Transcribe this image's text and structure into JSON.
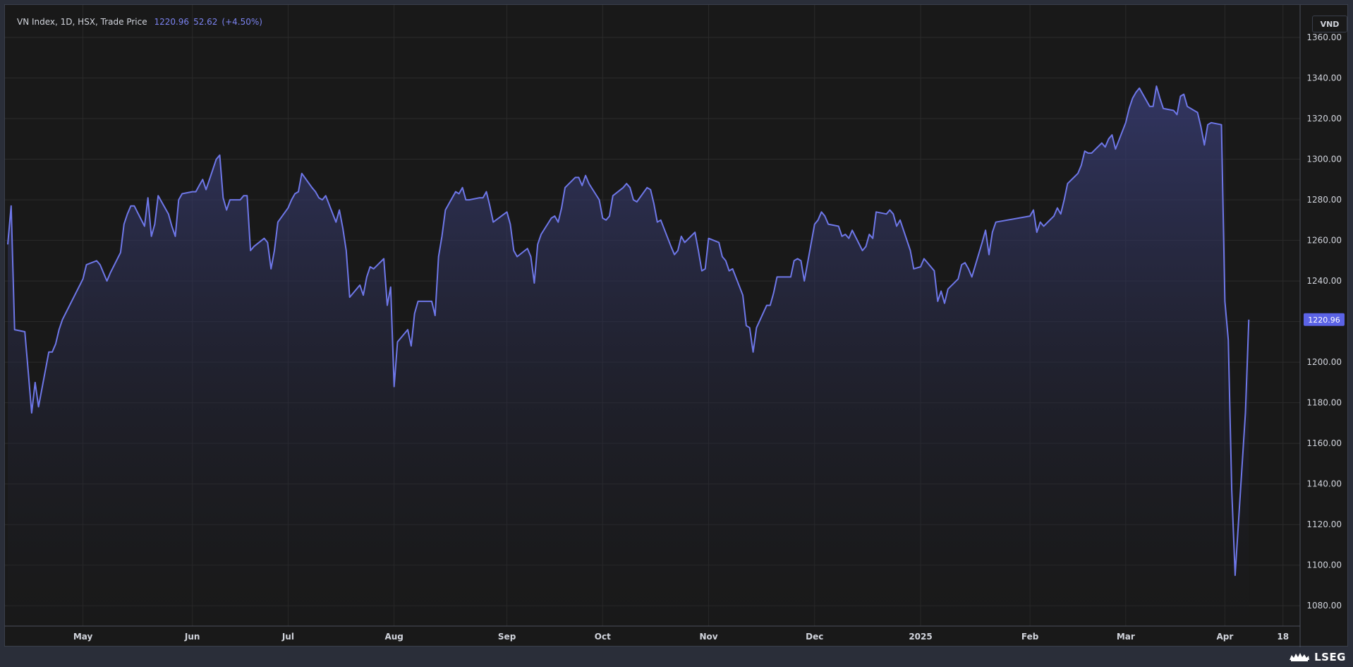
{
  "legend": {
    "title": "VN Index, 1D, HSX, Trade Price",
    "last": "1220.96",
    "change": "52.62",
    "change_pct": "(+4.50%)"
  },
  "currency": "VND",
  "last_price_label": "1220.96",
  "brand": {
    "name": "LSEG",
    "icon": "lseg-logo-icon"
  },
  "colors": {
    "line": "#6e77e8",
    "fill_top": "#3a3f7a",
    "fill_bottom": "#191919",
    "background": "#191919",
    "grid": "#2b2b2b",
    "label_bg": "#5b63e6"
  },
  "chart_data": {
    "type": "area",
    "title": "",
    "xlabel": "",
    "ylabel": "",
    "ylim": [
      1070,
      1376
    ],
    "y_ticks": [
      "1080.00",
      "1100.00",
      "1120.00",
      "1140.00",
      "1160.00",
      "1180.00",
      "1200.00",
      "1220.00",
      "1240.00",
      "1260.00",
      "1280.00",
      "1300.00",
      "1320.00",
      "1340.00",
      "1360.00"
    ],
    "x_ticks": [
      {
        "label": "May",
        "date": "2024-05-02"
      },
      {
        "label": "Jun",
        "date": "2024-06-03"
      },
      {
        "label": "Jul",
        "date": "2024-07-01"
      },
      {
        "label": "Aug",
        "date": "2024-08-01"
      },
      {
        "label": "Sep",
        "date": "2024-09-03"
      },
      {
        "label": "Oct",
        "date": "2024-10-01"
      },
      {
        "label": "Nov",
        "date": "2024-11-01"
      },
      {
        "label": "Dec",
        "date": "2024-12-02"
      },
      {
        "label": "2025",
        "date": "2025-01-02"
      },
      {
        "label": "Feb",
        "date": "2025-02-03"
      },
      {
        "label": "Mar",
        "date": "2025-03-03"
      },
      {
        "label": "Apr",
        "date": "2025-04-01"
      },
      {
        "label": "18",
        "date": "2025-04-18"
      }
    ],
    "x_range": [
      "2024-04-10",
      "2025-04-23"
    ],
    "series": [
      {
        "points": [
          [
            "2024-04-10",
            1258
          ],
          [
            "2024-04-11",
            1277
          ],
          [
            "2024-04-12",
            1216
          ],
          [
            "2024-04-15",
            1215
          ],
          [
            "2024-04-16",
            1195
          ],
          [
            "2024-04-17",
            1175
          ],
          [
            "2024-04-18",
            1190
          ],
          [
            "2024-04-19",
            1178
          ],
          [
            "2024-04-22",
            1205
          ],
          [
            "2024-04-23",
            1205
          ],
          [
            "2024-04-24",
            1209
          ],
          [
            "2024-04-25",
            1216
          ],
          [
            "2024-04-26",
            1221
          ],
          [
            "2024-05-02",
            1241
          ],
          [
            "2024-05-03",
            1248
          ],
          [
            "2024-05-06",
            1250
          ],
          [
            "2024-05-07",
            1248
          ],
          [
            "2024-05-08",
            1244
          ],
          [
            "2024-05-09",
            1240
          ],
          [
            "2024-05-10",
            1244
          ],
          [
            "2024-05-13",
            1254
          ],
          [
            "2024-05-14",
            1268
          ],
          [
            "2024-05-15",
            1273
          ],
          [
            "2024-05-16",
            1277
          ],
          [
            "2024-05-17",
            1277
          ],
          [
            "2024-05-20",
            1267
          ],
          [
            "2024-05-21",
            1281
          ],
          [
            "2024-05-22",
            1262
          ],
          [
            "2024-05-23",
            1268
          ],
          [
            "2024-05-24",
            1282
          ],
          [
            "2024-05-27",
            1273
          ],
          [
            "2024-05-28",
            1267
          ],
          [
            "2024-05-29",
            1262
          ],
          [
            "2024-05-30",
            1280
          ],
          [
            "2024-05-31",
            1283
          ],
          [
            "2024-06-03",
            1284
          ],
          [
            "2024-06-04",
            1284
          ],
          [
            "2024-06-05",
            1287
          ],
          [
            "2024-06-06",
            1290
          ],
          [
            "2024-06-07",
            1285
          ],
          [
            "2024-06-10",
            1300
          ],
          [
            "2024-06-11",
            1302
          ],
          [
            "2024-06-12",
            1281
          ],
          [
            "2024-06-13",
            1275
          ],
          [
            "2024-06-14",
            1280
          ],
          [
            "2024-06-17",
            1280
          ],
          [
            "2024-06-18",
            1282
          ],
          [
            "2024-06-19",
            1282
          ],
          [
            "2024-06-20",
            1255
          ],
          [
            "2024-06-21",
            1257
          ],
          [
            "2024-06-24",
            1261
          ],
          [
            "2024-06-25",
            1259
          ],
          [
            "2024-06-26",
            1246
          ],
          [
            "2024-06-27",
            1255
          ],
          [
            "2024-06-28",
            1269
          ],
          [
            "2024-07-01",
            1276
          ],
          [
            "2024-07-02",
            1280
          ],
          [
            "2024-07-03",
            1283
          ],
          [
            "2024-07-04",
            1284
          ],
          [
            "2024-07-05",
            1293
          ],
          [
            "2024-07-08",
            1286
          ],
          [
            "2024-07-09",
            1284
          ],
          [
            "2024-07-10",
            1281
          ],
          [
            "2024-07-11",
            1280
          ],
          [
            "2024-07-12",
            1282
          ],
          [
            "2024-07-15",
            1269
          ],
          [
            "2024-07-16",
            1275
          ],
          [
            "2024-07-17",
            1266
          ],
          [
            "2024-07-18",
            1255
          ],
          [
            "2024-07-19",
            1232
          ],
          [
            "2024-07-22",
            1238
          ],
          [
            "2024-07-23",
            1233
          ],
          [
            "2024-07-24",
            1242
          ],
          [
            "2024-07-25",
            1247
          ],
          [
            "2024-07-26",
            1246
          ],
          [
            "2024-07-29",
            1251
          ],
          [
            "2024-07-30",
            1228
          ],
          [
            "2024-07-31",
            1237
          ],
          [
            "2024-08-01",
            1188
          ],
          [
            "2024-08-02",
            1210
          ],
          [
            "2024-08-05",
            1216
          ],
          [
            "2024-08-06",
            1208
          ],
          [
            "2024-08-07",
            1224
          ],
          [
            "2024-08-08",
            1230
          ],
          [
            "2024-08-09",
            1230
          ],
          [
            "2024-08-12",
            1230
          ],
          [
            "2024-08-13",
            1223
          ],
          [
            "2024-08-14",
            1252
          ],
          [
            "2024-08-15",
            1262
          ],
          [
            "2024-08-16",
            1275
          ],
          [
            "2024-08-19",
            1284
          ],
          [
            "2024-08-20",
            1283
          ],
          [
            "2024-08-21",
            1286
          ],
          [
            "2024-08-22",
            1280
          ],
          [
            "2024-08-23",
            1280
          ],
          [
            "2024-08-26",
            1281
          ],
          [
            "2024-08-27",
            1281
          ],
          [
            "2024-08-28",
            1284
          ],
          [
            "2024-08-29",
            1277
          ],
          [
            "2024-08-30",
            1269
          ],
          [
            "2024-09-03",
            1274
          ],
          [
            "2024-09-04",
            1268
          ],
          [
            "2024-09-05",
            1255
          ],
          [
            "2024-09-06",
            1252
          ],
          [
            "2024-09-09",
            1256
          ],
          [
            "2024-09-10",
            1252
          ],
          [
            "2024-09-11",
            1239
          ],
          [
            "2024-09-12",
            1258
          ],
          [
            "2024-09-13",
            1263
          ],
          [
            "2024-09-16",
            1271
          ],
          [
            "2024-09-17",
            1272
          ],
          [
            "2024-09-18",
            1269
          ],
          [
            "2024-09-19",
            1276
          ],
          [
            "2024-09-20",
            1286
          ],
          [
            "2024-09-23",
            1291
          ],
          [
            "2024-09-24",
            1291
          ],
          [
            "2024-09-25",
            1287
          ],
          [
            "2024-09-26",
            1292
          ],
          [
            "2024-09-27",
            1288
          ],
          [
            "2024-09-30",
            1280
          ],
          [
            "2024-10-01",
            1271
          ],
          [
            "2024-10-02",
            1270
          ],
          [
            "2024-10-03",
            1272
          ],
          [
            "2024-10-04",
            1282
          ],
          [
            "2024-10-07",
            1286
          ],
          [
            "2024-10-08",
            1288
          ],
          [
            "2024-10-09",
            1286
          ],
          [
            "2024-10-10",
            1280
          ],
          [
            "2024-10-11",
            1279
          ],
          [
            "2024-10-14",
            1286
          ],
          [
            "2024-10-15",
            1285
          ],
          [
            "2024-10-16",
            1278
          ],
          [
            "2024-10-17",
            1269
          ],
          [
            "2024-10-18",
            1270
          ],
          [
            "2024-10-21",
            1257
          ],
          [
            "2024-10-22",
            1253
          ],
          [
            "2024-10-23",
            1255
          ],
          [
            "2024-10-24",
            1262
          ],
          [
            "2024-10-25",
            1259
          ],
          [
            "2024-10-28",
            1264
          ],
          [
            "2024-10-29",
            1255
          ],
          [
            "2024-10-30",
            1245
          ],
          [
            "2024-10-31",
            1246
          ],
          [
            "2024-11-01",
            1261
          ],
          [
            "2024-11-04",
            1259
          ],
          [
            "2024-11-05",
            1252
          ],
          [
            "2024-11-06",
            1250
          ],
          [
            "2024-11-07",
            1245
          ],
          [
            "2024-11-08",
            1246
          ],
          [
            "2024-11-11",
            1233
          ],
          [
            "2024-11-12",
            1218
          ],
          [
            "2024-11-13",
            1217
          ],
          [
            "2024-11-14",
            1205
          ],
          [
            "2024-11-15",
            1217
          ],
          [
            "2024-11-18",
            1228
          ],
          [
            "2024-11-19",
            1228
          ],
          [
            "2024-11-20",
            1234
          ],
          [
            "2024-11-21",
            1242
          ],
          [
            "2024-11-22",
            1242
          ],
          [
            "2024-11-25",
            1242
          ],
          [
            "2024-11-26",
            1250
          ],
          [
            "2024-11-27",
            1251
          ],
          [
            "2024-11-28",
            1250
          ],
          [
            "2024-11-29",
            1240
          ],
          [
            "2024-12-02",
            1268
          ],
          [
            "2024-12-03",
            1270
          ],
          [
            "2024-12-04",
            1274
          ],
          [
            "2024-12-05",
            1272
          ],
          [
            "2024-12-06",
            1268
          ],
          [
            "2024-12-09",
            1267
          ],
          [
            "2024-12-10",
            1262
          ],
          [
            "2024-12-11",
            1263
          ],
          [
            "2024-12-12",
            1261
          ],
          [
            "2024-12-13",
            1265
          ],
          [
            "2024-12-16",
            1255
          ],
          [
            "2024-12-17",
            1257
          ],
          [
            "2024-12-18",
            1263
          ],
          [
            "2024-12-19",
            1261
          ],
          [
            "2024-12-20",
            1274
          ],
          [
            "2024-12-23",
            1273
          ],
          [
            "2024-12-24",
            1275
          ],
          [
            "2024-12-25",
            1273
          ],
          [
            "2024-12-26",
            1267
          ],
          [
            "2024-12-27",
            1270
          ],
          [
            "2024-12-30",
            1255
          ],
          [
            "2024-12-31",
            1246
          ],
          [
            "2025-01-02",
            1247
          ],
          [
            "2025-01-03",
            1251
          ],
          [
            "2025-01-06",
            1245
          ],
          [
            "2025-01-07",
            1230
          ],
          [
            "2025-01-08",
            1235
          ],
          [
            "2025-01-09",
            1229
          ],
          [
            "2025-01-10",
            1236
          ],
          [
            "2025-01-13",
            1241
          ],
          [
            "2025-01-14",
            1248
          ],
          [
            "2025-01-15",
            1249
          ],
          [
            "2025-01-16",
            1246
          ],
          [
            "2025-01-17",
            1242
          ],
          [
            "2025-01-20",
            1259
          ],
          [
            "2025-01-21",
            1265
          ],
          [
            "2025-01-22",
            1253
          ],
          [
            "2025-01-23",
            1264
          ],
          [
            "2025-01-24",
            1269
          ],
          [
            "2025-02-03",
            1272
          ],
          [
            "2025-02-04",
            1275
          ],
          [
            "2025-02-05",
            1264
          ],
          [
            "2025-02-06",
            1269
          ],
          [
            "2025-02-07",
            1267
          ],
          [
            "2025-02-10",
            1272
          ],
          [
            "2025-02-11",
            1276
          ],
          [
            "2025-02-12",
            1273
          ],
          [
            "2025-02-13",
            1280
          ],
          [
            "2025-02-14",
            1288
          ],
          [
            "2025-02-17",
            1293
          ],
          [
            "2025-02-18",
            1297
          ],
          [
            "2025-02-19",
            1304
          ],
          [
            "2025-02-20",
            1303
          ],
          [
            "2025-02-21",
            1303
          ],
          [
            "2025-02-24",
            1308
          ],
          [
            "2025-02-25",
            1306
          ],
          [
            "2025-02-26",
            1310
          ],
          [
            "2025-02-27",
            1312
          ],
          [
            "2025-02-28",
            1305
          ],
          [
            "2025-03-03",
            1318
          ],
          [
            "2025-03-04",
            1325
          ],
          [
            "2025-03-05",
            1330
          ],
          [
            "2025-03-06",
            1333
          ],
          [
            "2025-03-07",
            1335
          ],
          [
            "2025-03-10",
            1326
          ],
          [
            "2025-03-11",
            1326
          ],
          [
            "2025-03-12",
            1336
          ],
          [
            "2025-03-13",
            1330
          ],
          [
            "2025-03-14",
            1325
          ],
          [
            "2025-03-17",
            1324
          ],
          [
            "2025-03-18",
            1322
          ],
          [
            "2025-03-19",
            1331
          ],
          [
            "2025-03-20",
            1332
          ],
          [
            "2025-03-21",
            1326
          ],
          [
            "2025-03-24",
            1323
          ],
          [
            "2025-03-25",
            1316
          ],
          [
            "2025-03-26",
            1307
          ],
          [
            "2025-03-27",
            1317
          ],
          [
            "2025-03-28",
            1318
          ],
          [
            "2025-03-31",
            1317
          ],
          [
            "2025-04-01",
            1230
          ],
          [
            "2025-04-02",
            1211
          ],
          [
            "2025-04-03",
            1137
          ],
          [
            "2025-04-04",
            1095
          ],
          [
            "2025-04-07",
            1175
          ],
          [
            "2025-04-08",
            1221
          ]
        ]
      }
    ]
  }
}
